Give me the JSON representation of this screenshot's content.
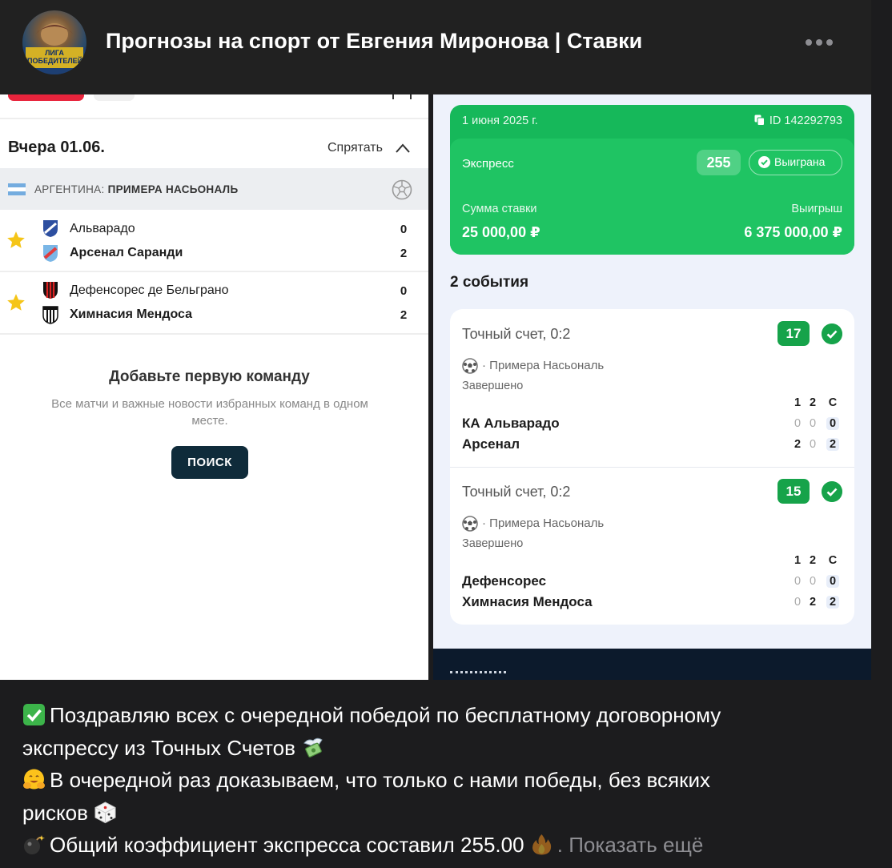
{
  "header": {
    "channel_title": "Прогнозы на спорт от Евгения Миронова | Ставки",
    "avatar_text": "ЛИГА ПОБЕДИТЕЛЕЙ"
  },
  "left_app": {
    "date_label": "Вчера 01.06.",
    "hide_label": "Спрятать",
    "league_country": "АРГЕНТИНА:",
    "league_name": "ПРИМЕРА НАСЬОНАЛЬ",
    "matches": [
      {
        "home": "Альварадо",
        "away": "Арсенал Саранди",
        "home_score": "0",
        "away_score": "2"
      },
      {
        "home": "Дефенсорес де Бельграно",
        "away": "Химнасия Мендоса",
        "home_score": "0",
        "away_score": "2"
      }
    ],
    "empty_title": "Добавьте первую команду",
    "empty_desc": "Все матчи и важные новости избранных команд в одном месте.",
    "search_label": "ПОИСК"
  },
  "right_app": {
    "ticket": {
      "date": "1 июня 2025 г.",
      "id": "ID 142292793",
      "type": "Экспресс",
      "coef": "255",
      "status": "Выиграна",
      "stake_label": "Сумма ставки",
      "stake_value": "25 000,00 ₽",
      "win_label": "Выигрыш",
      "win_value": "6 375 000,00 ₽"
    },
    "events_title": "2 события",
    "events": [
      {
        "market": "Точный счет, 0:2",
        "coef": "17",
        "league": "· Примера Насьональ",
        "status": "Завершено",
        "cols": [
          "1",
          "2",
          "С"
        ],
        "team1": "КА Альварадо",
        "team1_scores": [
          "0",
          "0",
          "0"
        ],
        "team2": "Арсенал",
        "team2_scores": [
          "2",
          "0",
          "2"
        ]
      },
      {
        "market": "Точный счет, 0:2",
        "coef": "15",
        "league": "· Примера Насьональ",
        "status": "Завершено",
        "cols": [
          "1",
          "2",
          "С"
        ],
        "team1": "Дефенсорес",
        "team1_scores": [
          "0",
          "0",
          "0"
        ],
        "team2": "Химнасия Мендоса",
        "team2_scores": [
          "0",
          "2",
          "2"
        ]
      }
    ]
  },
  "message": {
    "line1": "Поздравляю всех с очередной победой по бесплатному договорному",
    "line2": "экспрессу из Точных Счетов",
    "line3": "В очередной раз доказываем, что только с нами победы, без всяких",
    "line4": "рисков",
    "line5": "Общий коэффициент экспресса составил 255.00",
    "show_more": ". Показать ещё",
    "emojis": [
      "check-mark-emoji",
      "money-with-wings-emoji",
      "hugging-face-emoji",
      "game-die-emoji",
      "bomb-emoji",
      "fire-emoji"
    ]
  },
  "colors": {
    "accent_green": "#1fc463",
    "badge_green": "#16a34a",
    "brand_red": "#e8243c",
    "dark_button": "#0f2b3a"
  }
}
